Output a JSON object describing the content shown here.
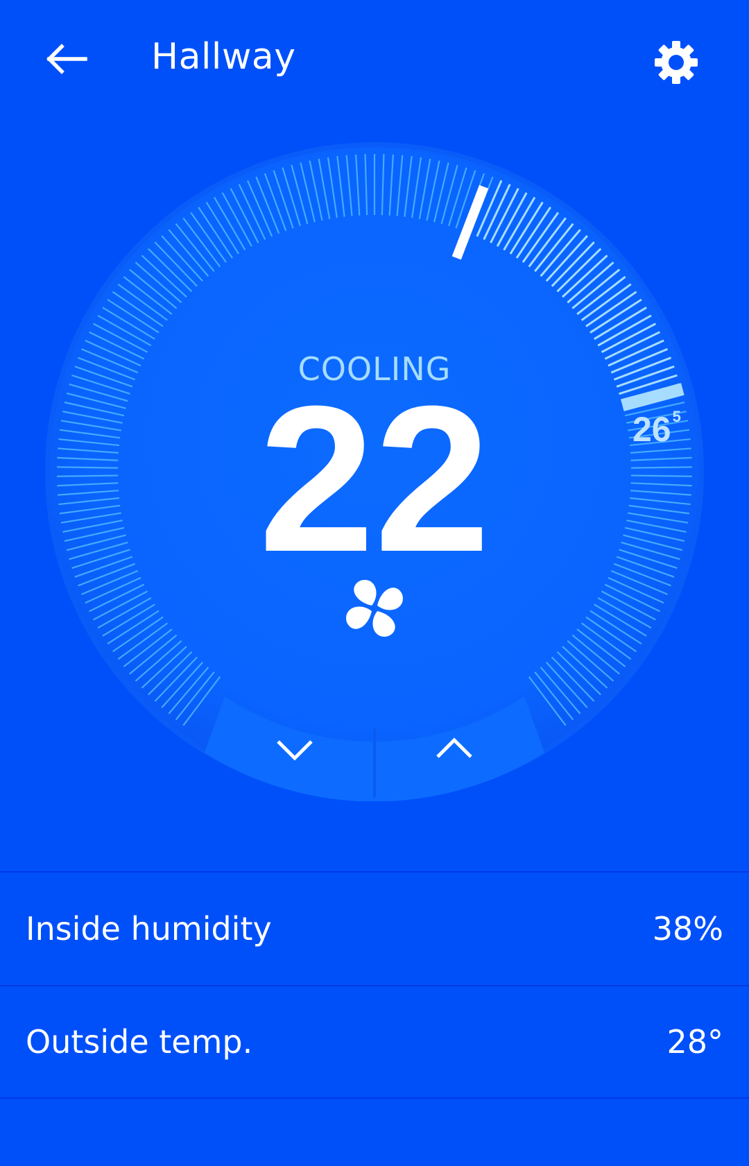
{
  "header": {
    "title": "Hallway",
    "back_icon": "arrow-left-icon",
    "settings_icon": "gear-icon"
  },
  "thermostat": {
    "mode": "COOLING",
    "current_temp": "22",
    "target_temp_whole": "26",
    "target_temp_fraction": "5",
    "fan_icon": "fan-icon",
    "decrease_icon": "chevron-down-icon",
    "increase_icon": "chevron-up-icon"
  },
  "info": [
    {
      "label": "Inside humidity",
      "value": "38%"
    },
    {
      "label": "Outside temp.",
      "value": "28°"
    }
  ],
  "colors": {
    "background": "#0050fa",
    "dial_face": "#0a66ff",
    "tick": "#4db8ff",
    "tick_active": "#a6ddff",
    "mode_text": "#a6ddff"
  }
}
